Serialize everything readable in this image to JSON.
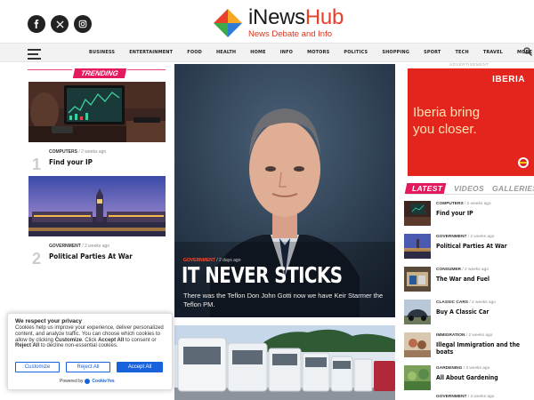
{
  "header": {
    "social": [
      {
        "icon": "facebook-icon"
      },
      {
        "icon": "x-twitter-icon"
      },
      {
        "icon": "instagram-icon"
      }
    ],
    "logo": {
      "name_part1": "iNews",
      "name_part2": "Hub",
      "tagline": "News Debate and Info"
    }
  },
  "nav": {
    "items": [
      "BUSINESS",
      "ENTERTAINMENT",
      "FOOD",
      "HEALTH",
      "HOME",
      "INFO",
      "MOTORS",
      "POLITICS",
      "SHOPPING",
      "SPORT",
      "TECH",
      "TRAVEL",
      "MORE ▾"
    ]
  },
  "trending": {
    "label": "TRENDING",
    "cards": [
      {
        "num": "1",
        "category": "COMPUTERS",
        "time": "2 weeks ago",
        "title": "Find your IP"
      },
      {
        "num": "2",
        "category": "GOVERNMENT",
        "time": "2 weeks ago",
        "title": "Political Parties At War"
      }
    ]
  },
  "hero": {
    "category": "GOVERNMENT",
    "time": "2 days ago",
    "title": "IT NEVER STICKS",
    "subtitle": "There was the Teflon Don John Gotti now we have Keir Starmer the Teflon PM."
  },
  "ad": {
    "label": "ADVERTISEMENT",
    "brand": "IBERIA",
    "slogan": "Iberia bring you closer."
  },
  "sidebar": {
    "tabs": [
      "LATEST",
      "VIDEOS",
      "GALLERIES"
    ],
    "items": [
      {
        "category": "COMPUTERS",
        "time": "2 weeks ago",
        "title": "Find your IP"
      },
      {
        "category": "GOVERNMENT",
        "time": "2 weeks ago",
        "title": "Political Parties At War"
      },
      {
        "category": "CONSUMER",
        "time": "2 weeks ago",
        "title": "The War and Fuel"
      },
      {
        "category": "CLASSIC CARS",
        "time": "2 weeks ago",
        "title": "Buy A Classic Car"
      },
      {
        "category": "IMMIGRATION",
        "time": "2 weeks ago",
        "title": "Illegal Immigration and the boats"
      },
      {
        "category": "GARDENING",
        "time": "3 weeks ago",
        "title": "All About Gardening"
      },
      {
        "category": "GOVERNMENT",
        "time": "3 weeks ago"
      }
    ]
  },
  "cookie": {
    "title": "We respect your privacy",
    "body_1": "Cookies help us improve your experience, deliver personalized content, and analyze traffic. You can choose which cookies to allow by clicking",
    "b_customize": "Customize",
    "body_2": ". Click",
    "b_accept": "Accept All",
    "body_3": "to consent or",
    "b_reject": "Reject All",
    "body_4": "to decline non-essential cookies.",
    "customize_btn": "Customize",
    "reject_btn": "Reject All",
    "accept_btn": "Accept All",
    "powered_prefix": "Powered by",
    "powered_brand": "CookieYes"
  },
  "colors": {
    "accent": "#e5195e",
    "logo_red": "#e8412b",
    "cookie_blue": "#1863dc",
    "ad_red": "#e3251e"
  }
}
